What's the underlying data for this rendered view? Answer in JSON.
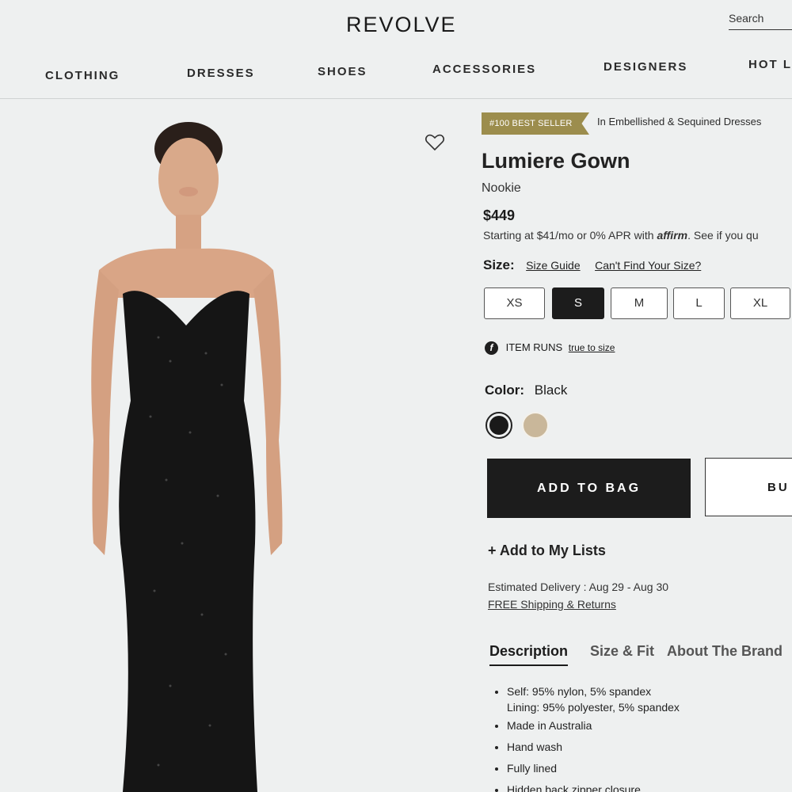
{
  "header": {
    "logo": "REVOLVE",
    "search_placeholder": "Search",
    "nav": [
      "CLOTHING",
      "DRESSES",
      "SHOES",
      "ACCESSORIES",
      "DESIGNERS",
      "HOT L"
    ]
  },
  "product": {
    "badge": "#100 BEST SELLER",
    "badge_category": "In Embellished & Sequined Dresses",
    "title": "Lumiere Gown",
    "brand": "Nookie",
    "price": "$449",
    "financing_prefix": "Starting at $41/mo or 0% APR with",
    "financing_brand": "affirm",
    "financing_suffix": ". See if you qu"
  },
  "size": {
    "label": "Size:",
    "guide_link": "Size Guide",
    "cant_find_link": "Can't Find Your Size?",
    "options": [
      "XS",
      "S",
      "M",
      "L",
      "XL"
    ],
    "selected": "S"
  },
  "fit": {
    "icon": "f",
    "text": "ITEM RUNS",
    "link": "true to size"
  },
  "color": {
    "label": "Color:",
    "value": "Black",
    "swatches": [
      {
        "name": "Black",
        "hex": "#1a1a1a"
      },
      {
        "name": "Gold",
        "hex": "#c9b79a"
      }
    ]
  },
  "actions": {
    "add_to_bag": "ADD TO BAG",
    "buy_now": "BU",
    "add_to_lists": "+ Add to My Lists"
  },
  "shipping": {
    "delivery": "Estimated Delivery : Aug 29 - Aug 30",
    "free_link": "FREE Shipping & Returns"
  },
  "tabs": [
    "Description",
    "Size & Fit",
    "About The Brand"
  ],
  "description": [
    "Self: 95% nylon, 5% spandex",
    "Lining: 95% polyester, 5% spandex",
    "Made in Australia",
    "Hand wash",
    "Fully lined",
    "Hidden back zipper closure"
  ],
  "colors": {
    "badge": "#9c8d4d",
    "primary": "#1c1c1c"
  }
}
